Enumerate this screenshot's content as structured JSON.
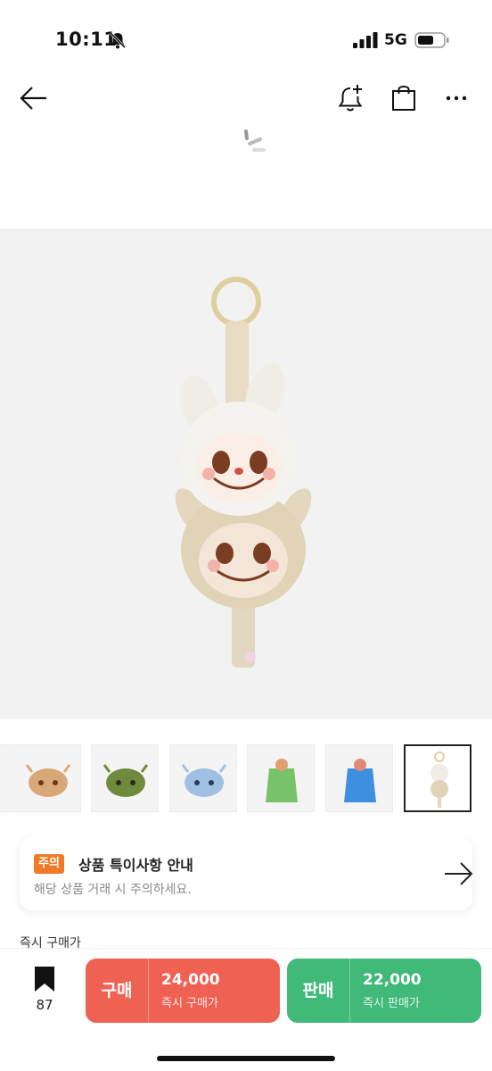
{
  "status_bar": {
    "time": "10:11",
    "network": "5G"
  },
  "nav": {
    "icons": [
      "back-arrow-icon",
      "alarm-add-icon",
      "shopping-bag-icon",
      "more-horizontal-icon"
    ]
  },
  "thumbnails": [
    {
      "name": "thumb-partial"
    },
    {
      "name": "thumb-tan-cap"
    },
    {
      "name": "thumb-green-cap"
    },
    {
      "name": "thumb-blue-cap"
    },
    {
      "name": "thumb-green-bag"
    },
    {
      "name": "thumb-blue-bag"
    },
    {
      "name": "thumb-keychain",
      "selected": true
    }
  ],
  "notice": {
    "badge": "주의",
    "title": "상품 특이사항 안내",
    "subtitle": "해당 상품 거래 시 주의하세요."
  },
  "section": {
    "label": "즉시 구매가"
  },
  "bottom_bar": {
    "wish_count": "87",
    "buy": {
      "kind": "구매",
      "price": "24,000",
      "sub": "즉시 구매가",
      "color": "#ef6253"
    },
    "sell": {
      "kind": "판매",
      "price": "22,000",
      "sub": "즉시 판매가",
      "color": "#41b979"
    }
  },
  "colors": {
    "notice_badge": "#f07a26",
    "image_bg": "#f2f2f2"
  }
}
